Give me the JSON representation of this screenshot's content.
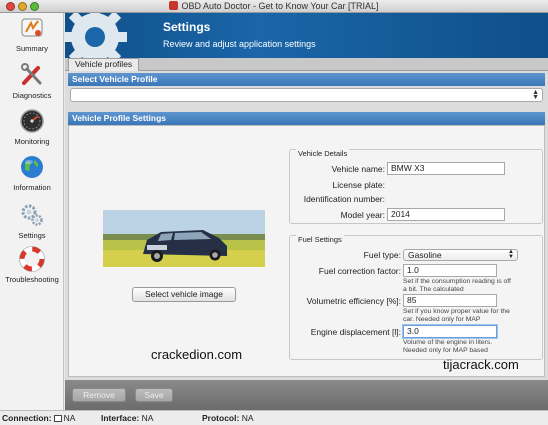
{
  "window": {
    "title": "OBD Auto Doctor - Get to Know Your Car [TRIAL]"
  },
  "sidebar": {
    "items": [
      {
        "label": "Summary",
        "icon": "summary-icon"
      },
      {
        "label": "Diagnostics",
        "icon": "wrench-screwdriver-icon"
      },
      {
        "label": "Monitoring",
        "icon": "gauge-icon"
      },
      {
        "label": "Information",
        "icon": "globe-icon"
      },
      {
        "label": "Settings",
        "icon": "gears-icon"
      },
      {
        "label": "Troubleshooting",
        "icon": "lifebuoy-icon"
      }
    ]
  },
  "header": {
    "title": "Settings",
    "subtitle": "Review and adjust application settings"
  },
  "tabs": [
    {
      "label": "Vehicle profiles",
      "active": true
    }
  ],
  "select_profile": {
    "section_title": "Select Vehicle Profile",
    "value": ""
  },
  "profile_settings": {
    "section_title": "Vehicle Profile Settings",
    "select_image_label": "Select vehicle image",
    "vehicle_details": {
      "group_title": "Vehicle Details",
      "fields": [
        {
          "label": "Vehicle name:",
          "value": "BMW X3"
        },
        {
          "label": "License plate:",
          "value": ""
        },
        {
          "label": "Identification number:",
          "value": ""
        },
        {
          "label": "Model year:",
          "value": "2014"
        }
      ]
    },
    "fuel_settings": {
      "group_title": "Fuel Settings",
      "fuel_type_label": "Fuel type:",
      "fuel_type_value": "Gasoline",
      "correction_label": "Fuel correction factor:",
      "correction_value": "1.0",
      "correction_hint": "Set if the consumption reading is off a bit. The calculated",
      "vol_eff_label": "Volumetric efficiency [%]:",
      "vol_eff_value": "85",
      "vol_eff_hint": "Set if you know proper value for the car. Needed only for MAP",
      "displacement_label": "Engine displacement [l]:",
      "displacement_value": "3.0",
      "displacement_hint": "Volume of the engine in liters. Needed only for MAP based"
    }
  },
  "watermarks": [
    "crackedion.com",
    "tijacrack.com"
  ],
  "buttons": {
    "remove_label": "Remove",
    "save_label": "Save"
  },
  "statusbar": {
    "connection_label": "Connection:",
    "connection_value": "NA",
    "interface_label": "Interface:",
    "interface_value": "NA",
    "protocol_label": "Protocol:",
    "protocol_value": "NA"
  },
  "colors": {
    "header_blue": "#1a66a8",
    "section_blue": "#3a76b7",
    "focus_blue": "#6b9fe0"
  }
}
